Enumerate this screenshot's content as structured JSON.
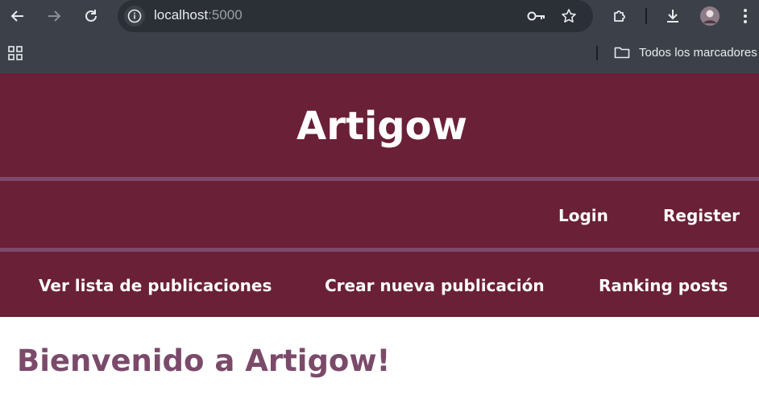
{
  "browser": {
    "url_host": "localhost",
    "url_port": ":5000",
    "bookmarks_folder_label": "Todos los marcadores"
  },
  "site": {
    "title": "Artigow",
    "auth": {
      "login_label": "Login",
      "register_label": "Register"
    },
    "nav": [
      {
        "label": "Ver lista de publicaciones"
      },
      {
        "label": "Crear nueva publicación"
      },
      {
        "label": "Ranking posts"
      }
    ],
    "welcome_heading": "Bienvenido a Artigow!"
  },
  "colors": {
    "header_bg": "#6a2036",
    "stripe": "#7b4a6a",
    "heading": "#7b4a6a",
    "browser_bg": "#3c4149"
  }
}
